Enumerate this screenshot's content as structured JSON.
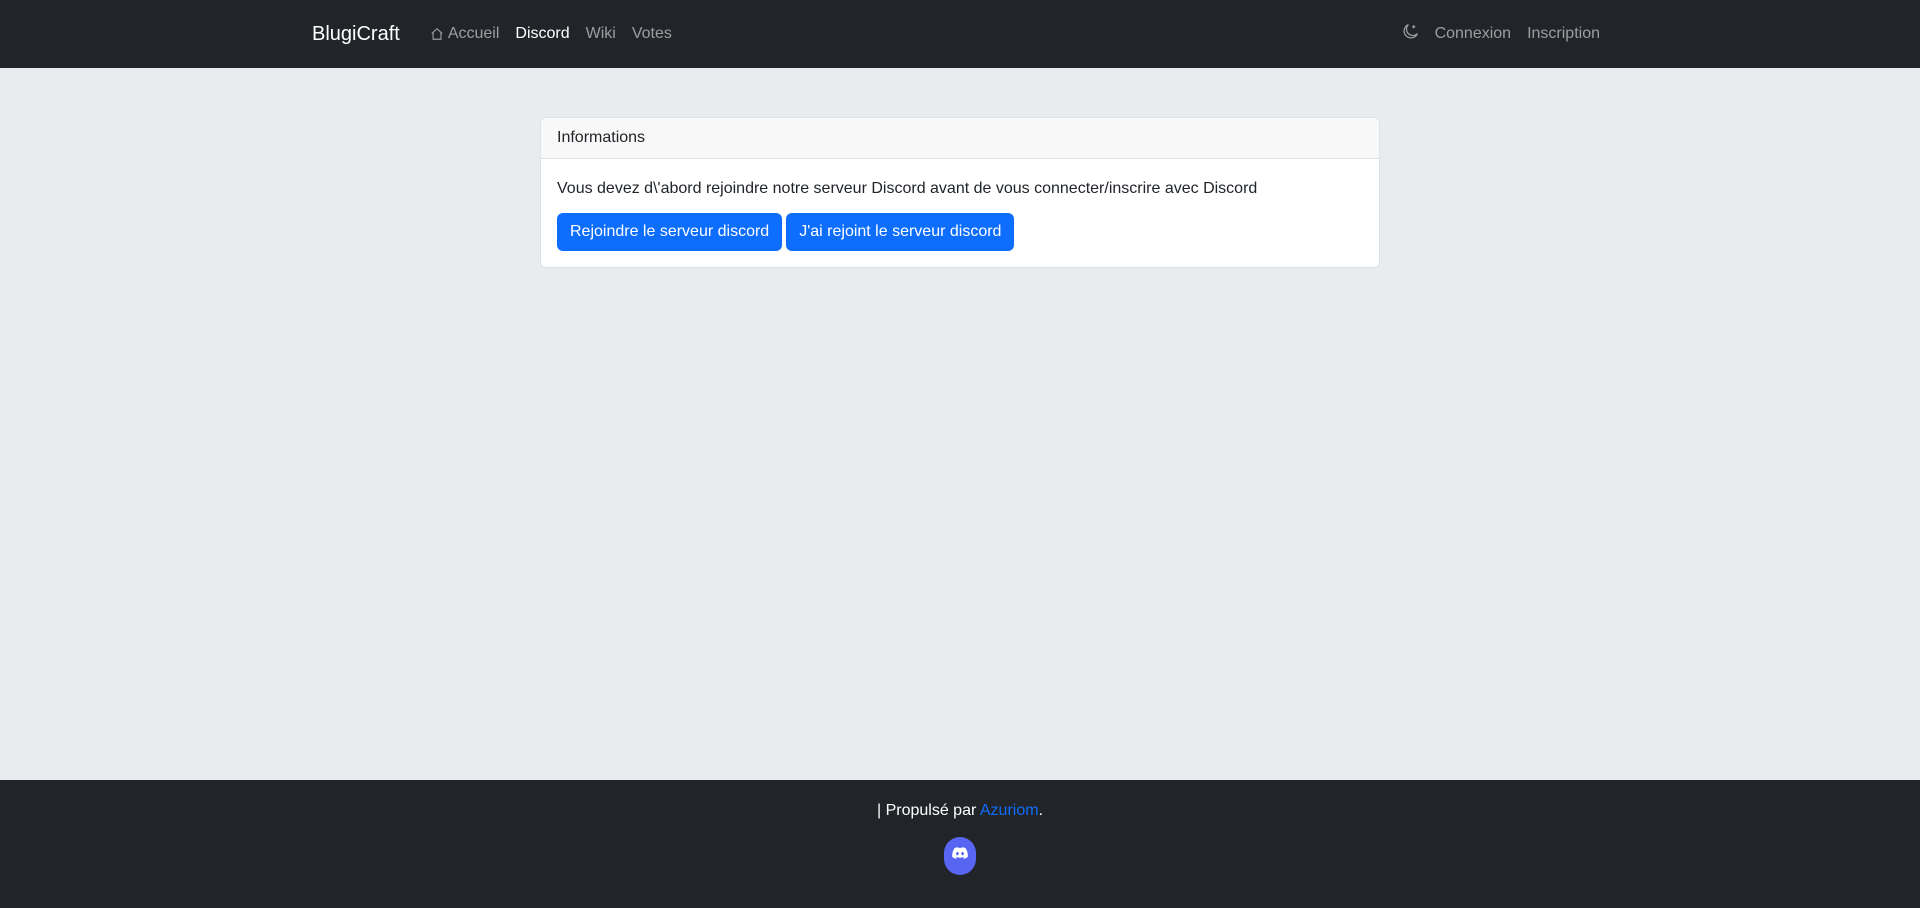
{
  "navbar": {
    "brand": "BlugiCraft",
    "links": [
      {
        "label": "Accueil",
        "icon": "house-icon",
        "active": false
      },
      {
        "label": "Discord",
        "active": true
      },
      {
        "label": "Wiki",
        "active": false
      },
      {
        "label": "Votes",
        "active": false
      }
    ],
    "theme_icon": "moon-stars-icon",
    "login_label": "Connexion",
    "register_label": "Inscription"
  },
  "card": {
    "header": "Informations",
    "message": "Vous devez d\\'abord rejoindre notre serveur Discord avant de vous connecter/inscrire avec Discord",
    "join_button": "Rejoindre le serveur discord",
    "joined_button": "J'ai rejoint le serveur discord"
  },
  "footer": {
    "prefix": "| Propulsé par ",
    "link_label": "Azuriom",
    "suffix": ".",
    "social_icon": "discord-icon"
  },
  "colors": {
    "navbar_bg": "#212529",
    "page_bg": "#e8ecef",
    "primary": "#0d6efd",
    "discord": "#5865f2"
  }
}
